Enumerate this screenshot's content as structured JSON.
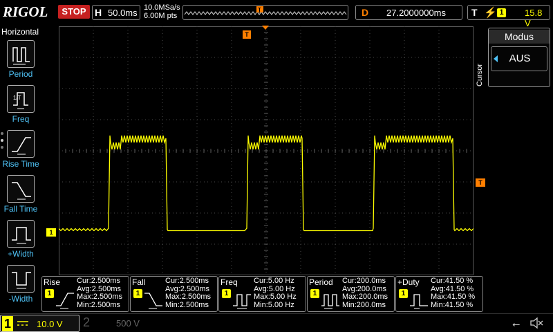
{
  "topbar": {
    "logo": "RIGOL",
    "run_state": "STOP",
    "horizontal_label": "H",
    "timebase": "50.0ms",
    "sample_rate": "10.0MSa/s",
    "memory_depth": "6.00M pts",
    "delay_label": "D",
    "delay_value": "27.2000000ms",
    "trigger_label": "T",
    "trigger_edge_icon": "rising-edge-icon",
    "trigger_source": "1",
    "trigger_level": "15.8 V"
  },
  "left_menu": {
    "heading": "Horizontal",
    "items": [
      {
        "label": "Period",
        "icon": "period-icon"
      },
      {
        "label": "Freq",
        "icon": "frequency-icon"
      },
      {
        "label": "Rise Time",
        "icon": "rise-time-icon"
      },
      {
        "label": "Fall Time",
        "icon": "fall-time-icon"
      },
      {
        "label": "+Width",
        "icon": "positive-width-icon"
      },
      {
        "label": "-Width",
        "icon": "negative-width-icon"
      }
    ]
  },
  "markers": {
    "trigger_position": "T",
    "trigger_level": "T",
    "ch1_ground": "1"
  },
  "right_panel": {
    "side_label": "Cursor",
    "title": "Modus",
    "value": "AUS"
  },
  "measurements": [
    {
      "name": "Rise",
      "channel": "1",
      "icon": "rise-icon",
      "cur": "Cur:2.500ms",
      "avg": "Avg:2.500ms",
      "max": "Max:2.500ms",
      "min": "Min:2.500ms"
    },
    {
      "name": "Fall",
      "channel": "1",
      "icon": "fall-icon",
      "cur": "Cur:2.500ms",
      "avg": "Avg:2.500ms",
      "max": "Max:2.500ms",
      "min": "Min:2.500ms"
    },
    {
      "name": "Freq",
      "channel": "1",
      "icon": "freq-icon",
      "cur": "Cur:5.00 Hz",
      "avg": "Avg:5.00 Hz",
      "max": "Max:5.00 Hz",
      "min": "Min:5.00 Hz"
    },
    {
      "name": "Period",
      "channel": "1",
      "icon": "period-icon",
      "cur": "Cur:200.0ms",
      "avg": "Avg:200.0ms",
      "max": "Max:200.0ms",
      "min": "Min:200.0ms"
    },
    {
      "name": "+Duty",
      "channel": "1",
      "icon": "duty-icon",
      "cur": "Cur:41.50 %",
      "avg": "Avg:41.50 %",
      "max": "Max:41.50 %",
      "min": "Min:41.50 %"
    }
  ],
  "bottombar": {
    "ch1_number": "1",
    "ch1_scale": "10.0 V",
    "ch2_number": "2",
    "ch2_scale": "500 V",
    "usb_icon": "usb-icon",
    "sound_icon": "mute-icon"
  },
  "colors": {
    "ch1": "#ffff00",
    "trigger": "#ff7f00",
    "accent": "#4fc3f7",
    "stop": "#c62020"
  }
}
